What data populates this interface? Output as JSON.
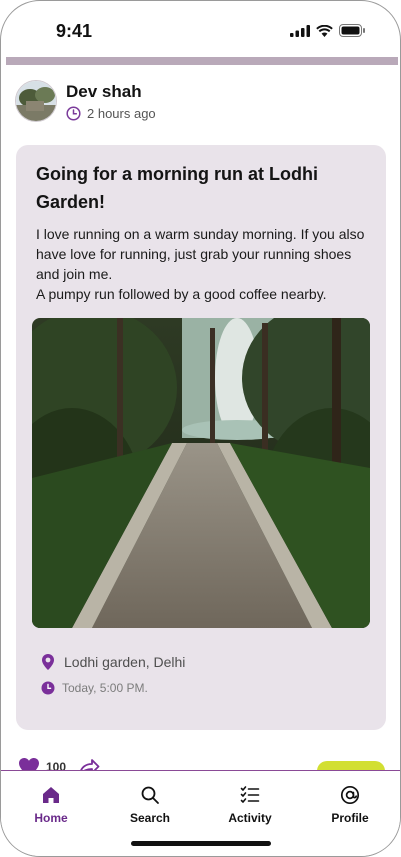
{
  "status_bar": {
    "time": "9:41"
  },
  "post": {
    "author": "Dev shah",
    "posted_ago": "2 hours ago",
    "title": "Going for a morning run at Lodhi Garden!",
    "body_lines": [
      "I love running on a warm sunday morning. If you also have love for running, just grab your running shoes and join me.",
      "A pumpy run followed by a good coffee nearby."
    ],
    "location": "Lodhi garden, Delhi",
    "event_time": "Today, 5:00 PM.",
    "likes": "100"
  },
  "colors": {
    "accent": "#6a2a8a",
    "card_bg": "#e9e3ea",
    "cta": "#d2df32"
  },
  "tabs": [
    {
      "label": "Home",
      "icon": "home-icon",
      "active": true
    },
    {
      "label": "Search",
      "icon": "search-icon",
      "active": false
    },
    {
      "label": "Activity",
      "icon": "checklist-icon",
      "active": false
    },
    {
      "label": "Profile",
      "icon": "at-sign-icon",
      "active": false
    }
  ]
}
